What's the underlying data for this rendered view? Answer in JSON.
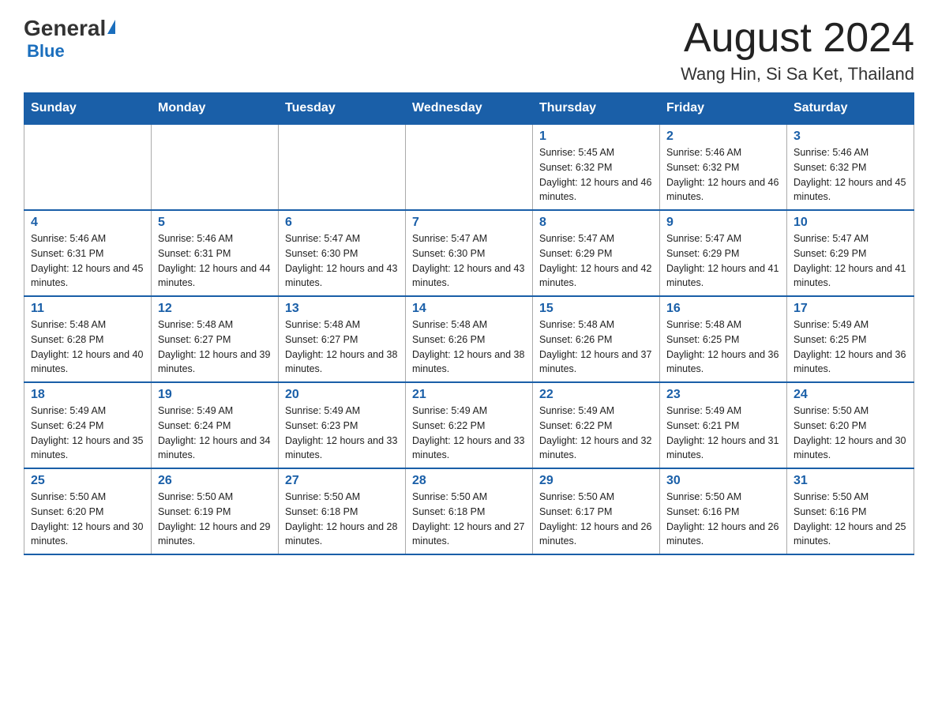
{
  "header": {
    "logo": {
      "general": "General",
      "blue": "Blue"
    },
    "title": "August 2024",
    "location": "Wang Hin, Si Sa Ket, Thailand"
  },
  "days_of_week": [
    "Sunday",
    "Monday",
    "Tuesday",
    "Wednesday",
    "Thursday",
    "Friday",
    "Saturday"
  ],
  "weeks": [
    [
      {
        "day": "",
        "info": ""
      },
      {
        "day": "",
        "info": ""
      },
      {
        "day": "",
        "info": ""
      },
      {
        "day": "",
        "info": ""
      },
      {
        "day": "1",
        "info": "Sunrise: 5:45 AM\nSunset: 6:32 PM\nDaylight: 12 hours and 46 minutes."
      },
      {
        "day": "2",
        "info": "Sunrise: 5:46 AM\nSunset: 6:32 PM\nDaylight: 12 hours and 46 minutes."
      },
      {
        "day": "3",
        "info": "Sunrise: 5:46 AM\nSunset: 6:32 PM\nDaylight: 12 hours and 45 minutes."
      }
    ],
    [
      {
        "day": "4",
        "info": "Sunrise: 5:46 AM\nSunset: 6:31 PM\nDaylight: 12 hours and 45 minutes."
      },
      {
        "day": "5",
        "info": "Sunrise: 5:46 AM\nSunset: 6:31 PM\nDaylight: 12 hours and 44 minutes."
      },
      {
        "day": "6",
        "info": "Sunrise: 5:47 AM\nSunset: 6:30 PM\nDaylight: 12 hours and 43 minutes."
      },
      {
        "day": "7",
        "info": "Sunrise: 5:47 AM\nSunset: 6:30 PM\nDaylight: 12 hours and 43 minutes."
      },
      {
        "day": "8",
        "info": "Sunrise: 5:47 AM\nSunset: 6:29 PM\nDaylight: 12 hours and 42 minutes."
      },
      {
        "day": "9",
        "info": "Sunrise: 5:47 AM\nSunset: 6:29 PM\nDaylight: 12 hours and 41 minutes."
      },
      {
        "day": "10",
        "info": "Sunrise: 5:47 AM\nSunset: 6:29 PM\nDaylight: 12 hours and 41 minutes."
      }
    ],
    [
      {
        "day": "11",
        "info": "Sunrise: 5:48 AM\nSunset: 6:28 PM\nDaylight: 12 hours and 40 minutes."
      },
      {
        "day": "12",
        "info": "Sunrise: 5:48 AM\nSunset: 6:27 PM\nDaylight: 12 hours and 39 minutes."
      },
      {
        "day": "13",
        "info": "Sunrise: 5:48 AM\nSunset: 6:27 PM\nDaylight: 12 hours and 38 minutes."
      },
      {
        "day": "14",
        "info": "Sunrise: 5:48 AM\nSunset: 6:26 PM\nDaylight: 12 hours and 38 minutes."
      },
      {
        "day": "15",
        "info": "Sunrise: 5:48 AM\nSunset: 6:26 PM\nDaylight: 12 hours and 37 minutes."
      },
      {
        "day": "16",
        "info": "Sunrise: 5:48 AM\nSunset: 6:25 PM\nDaylight: 12 hours and 36 minutes."
      },
      {
        "day": "17",
        "info": "Sunrise: 5:49 AM\nSunset: 6:25 PM\nDaylight: 12 hours and 36 minutes."
      }
    ],
    [
      {
        "day": "18",
        "info": "Sunrise: 5:49 AM\nSunset: 6:24 PM\nDaylight: 12 hours and 35 minutes."
      },
      {
        "day": "19",
        "info": "Sunrise: 5:49 AM\nSunset: 6:24 PM\nDaylight: 12 hours and 34 minutes."
      },
      {
        "day": "20",
        "info": "Sunrise: 5:49 AM\nSunset: 6:23 PM\nDaylight: 12 hours and 33 minutes."
      },
      {
        "day": "21",
        "info": "Sunrise: 5:49 AM\nSunset: 6:22 PM\nDaylight: 12 hours and 33 minutes."
      },
      {
        "day": "22",
        "info": "Sunrise: 5:49 AM\nSunset: 6:22 PM\nDaylight: 12 hours and 32 minutes."
      },
      {
        "day": "23",
        "info": "Sunrise: 5:49 AM\nSunset: 6:21 PM\nDaylight: 12 hours and 31 minutes."
      },
      {
        "day": "24",
        "info": "Sunrise: 5:50 AM\nSunset: 6:20 PM\nDaylight: 12 hours and 30 minutes."
      }
    ],
    [
      {
        "day": "25",
        "info": "Sunrise: 5:50 AM\nSunset: 6:20 PM\nDaylight: 12 hours and 30 minutes."
      },
      {
        "day": "26",
        "info": "Sunrise: 5:50 AM\nSunset: 6:19 PM\nDaylight: 12 hours and 29 minutes."
      },
      {
        "day": "27",
        "info": "Sunrise: 5:50 AM\nSunset: 6:18 PM\nDaylight: 12 hours and 28 minutes."
      },
      {
        "day": "28",
        "info": "Sunrise: 5:50 AM\nSunset: 6:18 PM\nDaylight: 12 hours and 27 minutes."
      },
      {
        "day": "29",
        "info": "Sunrise: 5:50 AM\nSunset: 6:17 PM\nDaylight: 12 hours and 26 minutes."
      },
      {
        "day": "30",
        "info": "Sunrise: 5:50 AM\nSunset: 6:16 PM\nDaylight: 12 hours and 26 minutes."
      },
      {
        "day": "31",
        "info": "Sunrise: 5:50 AM\nSunset: 6:16 PM\nDaylight: 12 hours and 25 minutes."
      }
    ]
  ]
}
